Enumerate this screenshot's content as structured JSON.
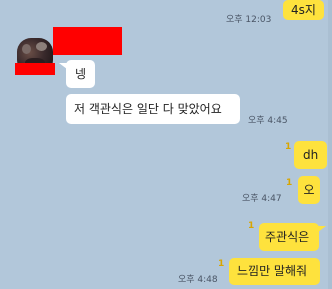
{
  "messages": [
    {
      "text": "4s지",
      "side": "out",
      "time": "오후 12:03",
      "unread": ""
    },
    {
      "text": "넹",
      "side": "in",
      "time": "",
      "unread": ""
    },
    {
      "text": "저 객관식은 일단 다 맞았어요",
      "side": "in",
      "time": "오후 4:45",
      "unread": ""
    },
    {
      "text": "dh",
      "side": "out",
      "time": "",
      "unread": "1"
    },
    {
      "text": "오",
      "side": "out",
      "time": "오후 4:47",
      "unread": "1"
    },
    {
      "text": "주관식은",
      "side": "out",
      "time": "",
      "unread": "1"
    },
    {
      "text": "느낌만 말해줘",
      "side": "out",
      "time": "오후 4:48",
      "unread": "1"
    }
  ],
  "colors": {
    "background": "#b2c7da",
    "outgoing_bubble": "#fee23d",
    "incoming_bubble": "#ffffff",
    "redaction": "#ff0000"
  },
  "sender": {
    "avatar": "profile-photo",
    "name_redacted": true
  }
}
